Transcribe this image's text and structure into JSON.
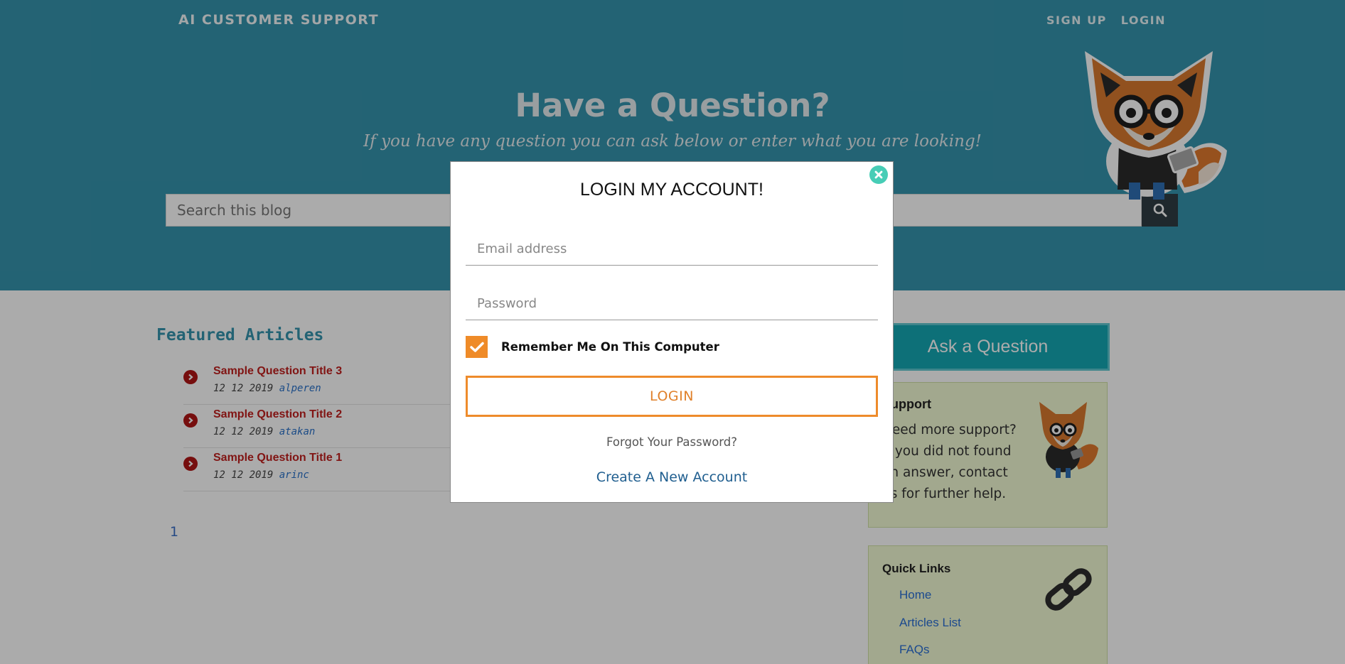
{
  "header": {
    "brand": "AI CUSTOMER SUPPORT",
    "nav": [
      {
        "label": "SIGN UP"
      },
      {
        "label": "LOGIN"
      }
    ]
  },
  "hero": {
    "title": "Have a Question?",
    "subtitle": "If you have any question you can ask below or enter what you are looking!",
    "search_placeholder": "Search this blog",
    "search_icon": "search-icon"
  },
  "featured": {
    "title": "Featured Articles",
    "articles": [
      {
        "title": "Sample Question Title 3",
        "date": "12 12 2019",
        "author": "alperen"
      },
      {
        "title": "Sample Question Title 2",
        "date": "12 12 2019",
        "author": "atakan"
      },
      {
        "title": "Sample Question Title 1",
        "date": "12 12 2019",
        "author": "arinc"
      }
    ],
    "page": "1"
  },
  "sidebar": {
    "ask_button": "Ask a Question",
    "support": {
      "title": "Support",
      "text": "Need more support? If you did not found an answer, contact us for further help."
    },
    "quick_links": {
      "title": "Quick Links",
      "items": [
        "Home",
        "Articles List",
        "FAQs"
      ]
    }
  },
  "modal": {
    "title": "LOGIN MY ACCOUNT!",
    "email_placeholder": "Email address",
    "password_placeholder": "Password",
    "remember_label": "Remember Me On This Computer",
    "remember_checked": true,
    "login_button": "LOGIN",
    "forgot_link": "Forgot Your Password?",
    "create_link": "Create A New Account"
  },
  "colors": {
    "hero_bg": "#3594ad",
    "accent_orange": "#ee8b2b",
    "ask_button": "#14a7b4",
    "close_button": "#47cdb6",
    "sidebar_box": "#f2fbd4",
    "article_title": "#c0201e"
  }
}
